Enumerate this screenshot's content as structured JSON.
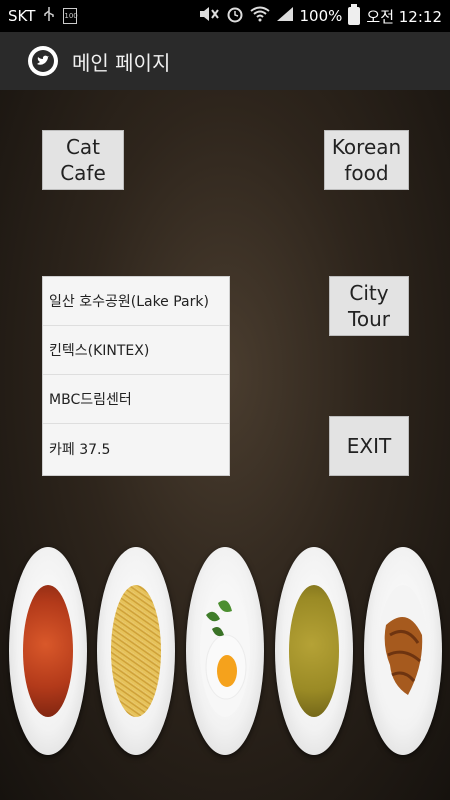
{
  "status_bar": {
    "carrier": "SKT",
    "battery_small": "100",
    "battery_percent": "100%",
    "time": "오전 12:12"
  },
  "action_bar": {
    "title": "메인 페이지",
    "logo_icon": "twitter-bird-icon"
  },
  "buttons": {
    "cat_cafe": "Cat\nCafe",
    "korean_food": "Korean\nfood",
    "city_tour": "City\nTour",
    "exit": "EXIT"
  },
  "list": {
    "items": [
      {
        "label": "일산 호수공원(Lake Park)"
      },
      {
        "label": "킨텍스(KINTEX)"
      },
      {
        "label": "MBC드림센터"
      },
      {
        "label": "카페   37.5"
      }
    ]
  },
  "dishes": [
    {
      "name": "tomato-seafood-soup",
      "color": "#b33a1a"
    },
    {
      "name": "spaghetti",
      "color": "#d9b24a"
    },
    {
      "name": "fried-egg-with-basil",
      "color": "#f5f5f5"
    },
    {
      "name": "curry-soup",
      "color": "#9a8a25"
    },
    {
      "name": "croissant",
      "color": "#a65a1e"
    }
  ]
}
